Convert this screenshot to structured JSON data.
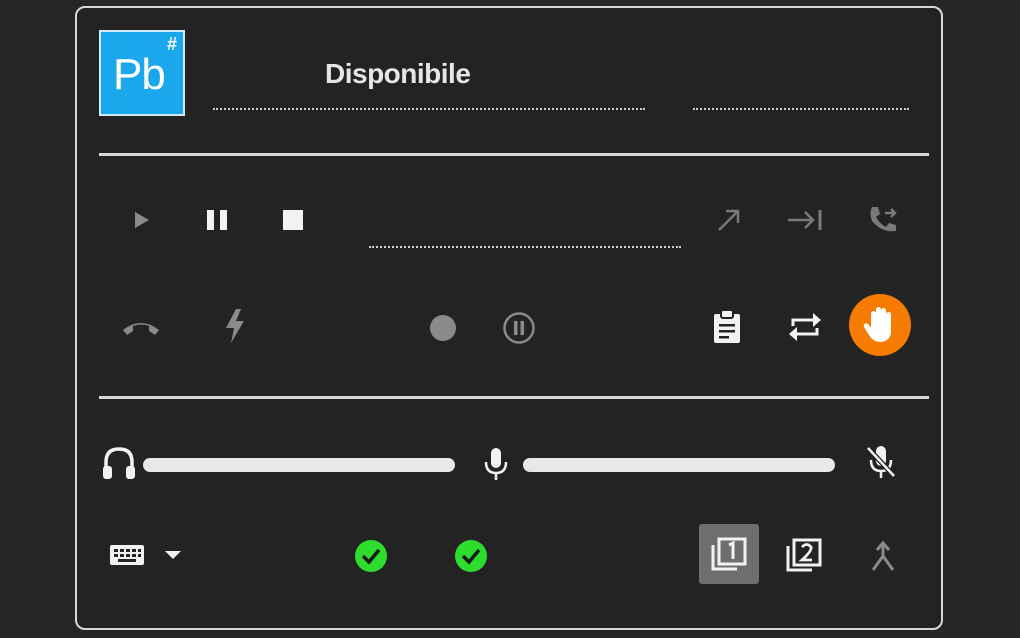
{
  "header": {
    "logo_text": "Pb",
    "logo_badge": "#",
    "status_label": "Disponibile"
  },
  "icons": {
    "play": "play-icon",
    "pause": "pause-icon",
    "stop": "stop-icon",
    "call_out": "arrow-up-right-icon",
    "transfer": "arrow-to-end-icon",
    "call_forward": "phone-forward-icon",
    "hangup": "hangup-icon",
    "flash": "flash-icon",
    "record": "record-icon",
    "record_pause": "pause-circle-icon",
    "clipboard": "clipboard-icon",
    "swap": "swap-icon",
    "hand": "hand-icon",
    "headphones": "headphones-icon",
    "mic": "microphone-icon",
    "mic_mute": "microphone-off-icon",
    "keyboard": "keyboard-icon",
    "dropdown": "caret-down-icon",
    "check_1": "check-circle-icon",
    "check_2": "check-circle-icon",
    "line_1": "line-1-icon",
    "line_2": "line-2-icon",
    "merge": "merge-icon"
  },
  "audio": {
    "speaker_level": 1.0,
    "mic_level": 1.0
  },
  "lines": {
    "selected": "1"
  },
  "colors": {
    "logo_bg": "#1aa7ec",
    "hand_button": "#f57c00",
    "check_ok": "#2ddc2d",
    "panel_border": "#d8d8d8",
    "background": "#262626"
  }
}
